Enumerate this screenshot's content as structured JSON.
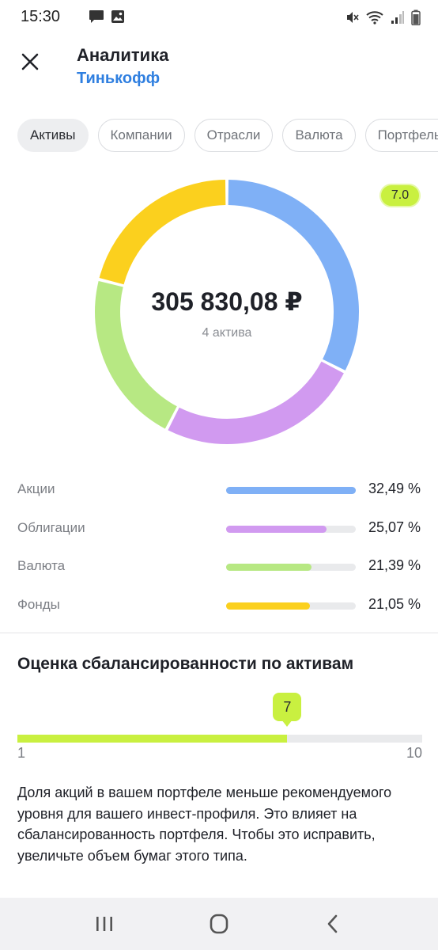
{
  "status_bar": {
    "time": "15:30",
    "left_icons": [
      "chat-icon",
      "image-icon"
    ],
    "right_icons": [
      "mute-icon",
      "wifi-icon",
      "signal-icon",
      "battery-icon"
    ]
  },
  "header": {
    "close_icon": "close-icon",
    "title": "Аналитика",
    "subtitle": "Тинькофф"
  },
  "tabs": [
    {
      "label": "Активы",
      "active": true
    },
    {
      "label": "Компании",
      "active": false
    },
    {
      "label": "Отрасли",
      "active": false
    },
    {
      "label": "Валюта",
      "active": false
    },
    {
      "label": "Портфель",
      "active": false
    }
  ],
  "summary": {
    "total": "305 830,08 ₽",
    "count": "4 актива",
    "score_badge": "7.0"
  },
  "allocation": [
    {
      "label": "Акции",
      "value": 32.49,
      "value_text": "32,49 %",
      "color": "#7fb0f6"
    },
    {
      "label": "Облигации",
      "value": 25.07,
      "value_text": "25,07 %",
      "color": "#d19af0"
    },
    {
      "label": "Валюта",
      "value": 21.39,
      "value_text": "21,39 %",
      "color": "#b7e883"
    },
    {
      "label": "Фонды",
      "value": 21.05,
      "value_text": "21,05 %",
      "color": "#fbd01e"
    }
  ],
  "balance": {
    "title": "Оценка сбалансированности по активам",
    "score": 7,
    "score_text": "7",
    "min": 1,
    "min_text": "1",
    "max": 10,
    "max_text": "10",
    "accent_color": "#c9f040",
    "advice": "Доля акций в вашем портфеле меньше рекомендуемого уровня для вашего инвест-профиля. Это влияет на сбалансированность портфеля. Чтобы это исправить, увеличьте объем бумаг этого типа."
  },
  "nav_bar": {
    "buttons": [
      "recent-apps-icon",
      "home-icon",
      "back-icon"
    ]
  }
}
